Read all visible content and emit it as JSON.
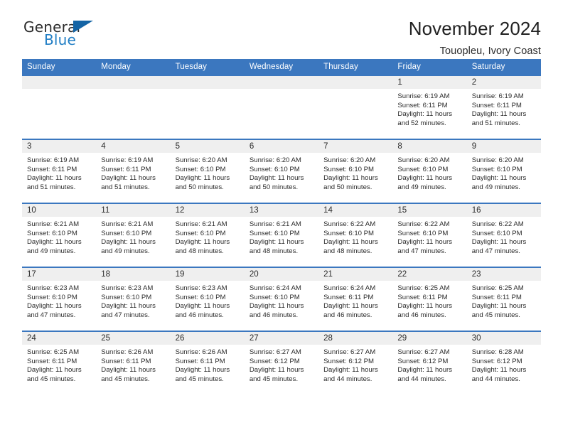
{
  "brand": {
    "name_part1": "General",
    "name_part2": "Blue",
    "triangle_color": "#1464a5",
    "blue_color": "#1f7dc4"
  },
  "header": {
    "title": "November 2024",
    "subtitle": "Touopleu, Ivory Coast",
    "header_bg": "#3b77bf",
    "daynum_bg": "#efefef"
  },
  "weekdays": [
    "Sunday",
    "Monday",
    "Tuesday",
    "Wednesday",
    "Thursday",
    "Friday",
    "Saturday"
  ],
  "weeks": [
    [
      {
        "day": "",
        "sunrise": "",
        "sunset": "",
        "daylight1": "",
        "daylight2": ""
      },
      {
        "day": "",
        "sunrise": "",
        "sunset": "",
        "daylight1": "",
        "daylight2": ""
      },
      {
        "day": "",
        "sunrise": "",
        "sunset": "",
        "daylight1": "",
        "daylight2": ""
      },
      {
        "day": "",
        "sunrise": "",
        "sunset": "",
        "daylight1": "",
        "daylight2": ""
      },
      {
        "day": "",
        "sunrise": "",
        "sunset": "",
        "daylight1": "",
        "daylight2": ""
      },
      {
        "day": "1",
        "sunrise": "Sunrise: 6:19 AM",
        "sunset": "Sunset: 6:11 PM",
        "daylight1": "Daylight: 11 hours",
        "daylight2": "and 52 minutes."
      },
      {
        "day": "2",
        "sunrise": "Sunrise: 6:19 AM",
        "sunset": "Sunset: 6:11 PM",
        "daylight1": "Daylight: 11 hours",
        "daylight2": "and 51 minutes."
      }
    ],
    [
      {
        "day": "3",
        "sunrise": "Sunrise: 6:19 AM",
        "sunset": "Sunset: 6:11 PM",
        "daylight1": "Daylight: 11 hours",
        "daylight2": "and 51 minutes."
      },
      {
        "day": "4",
        "sunrise": "Sunrise: 6:19 AM",
        "sunset": "Sunset: 6:11 PM",
        "daylight1": "Daylight: 11 hours",
        "daylight2": "and 51 minutes."
      },
      {
        "day": "5",
        "sunrise": "Sunrise: 6:20 AM",
        "sunset": "Sunset: 6:10 PM",
        "daylight1": "Daylight: 11 hours",
        "daylight2": "and 50 minutes."
      },
      {
        "day": "6",
        "sunrise": "Sunrise: 6:20 AM",
        "sunset": "Sunset: 6:10 PM",
        "daylight1": "Daylight: 11 hours",
        "daylight2": "and 50 minutes."
      },
      {
        "day": "7",
        "sunrise": "Sunrise: 6:20 AM",
        "sunset": "Sunset: 6:10 PM",
        "daylight1": "Daylight: 11 hours",
        "daylight2": "and 50 minutes."
      },
      {
        "day": "8",
        "sunrise": "Sunrise: 6:20 AM",
        "sunset": "Sunset: 6:10 PM",
        "daylight1": "Daylight: 11 hours",
        "daylight2": "and 49 minutes."
      },
      {
        "day": "9",
        "sunrise": "Sunrise: 6:20 AM",
        "sunset": "Sunset: 6:10 PM",
        "daylight1": "Daylight: 11 hours",
        "daylight2": "and 49 minutes."
      }
    ],
    [
      {
        "day": "10",
        "sunrise": "Sunrise: 6:21 AM",
        "sunset": "Sunset: 6:10 PM",
        "daylight1": "Daylight: 11 hours",
        "daylight2": "and 49 minutes."
      },
      {
        "day": "11",
        "sunrise": "Sunrise: 6:21 AM",
        "sunset": "Sunset: 6:10 PM",
        "daylight1": "Daylight: 11 hours",
        "daylight2": "and 49 minutes."
      },
      {
        "day": "12",
        "sunrise": "Sunrise: 6:21 AM",
        "sunset": "Sunset: 6:10 PM",
        "daylight1": "Daylight: 11 hours",
        "daylight2": "and 48 minutes."
      },
      {
        "day": "13",
        "sunrise": "Sunrise: 6:21 AM",
        "sunset": "Sunset: 6:10 PM",
        "daylight1": "Daylight: 11 hours",
        "daylight2": "and 48 minutes."
      },
      {
        "day": "14",
        "sunrise": "Sunrise: 6:22 AM",
        "sunset": "Sunset: 6:10 PM",
        "daylight1": "Daylight: 11 hours",
        "daylight2": "and 48 minutes."
      },
      {
        "day": "15",
        "sunrise": "Sunrise: 6:22 AM",
        "sunset": "Sunset: 6:10 PM",
        "daylight1": "Daylight: 11 hours",
        "daylight2": "and 47 minutes."
      },
      {
        "day": "16",
        "sunrise": "Sunrise: 6:22 AM",
        "sunset": "Sunset: 6:10 PM",
        "daylight1": "Daylight: 11 hours",
        "daylight2": "and 47 minutes."
      }
    ],
    [
      {
        "day": "17",
        "sunrise": "Sunrise: 6:23 AM",
        "sunset": "Sunset: 6:10 PM",
        "daylight1": "Daylight: 11 hours",
        "daylight2": "and 47 minutes."
      },
      {
        "day": "18",
        "sunrise": "Sunrise: 6:23 AM",
        "sunset": "Sunset: 6:10 PM",
        "daylight1": "Daylight: 11 hours",
        "daylight2": "and 47 minutes."
      },
      {
        "day": "19",
        "sunrise": "Sunrise: 6:23 AM",
        "sunset": "Sunset: 6:10 PM",
        "daylight1": "Daylight: 11 hours",
        "daylight2": "and 46 minutes."
      },
      {
        "day": "20",
        "sunrise": "Sunrise: 6:24 AM",
        "sunset": "Sunset: 6:10 PM",
        "daylight1": "Daylight: 11 hours",
        "daylight2": "and 46 minutes."
      },
      {
        "day": "21",
        "sunrise": "Sunrise: 6:24 AM",
        "sunset": "Sunset: 6:11 PM",
        "daylight1": "Daylight: 11 hours",
        "daylight2": "and 46 minutes."
      },
      {
        "day": "22",
        "sunrise": "Sunrise: 6:25 AM",
        "sunset": "Sunset: 6:11 PM",
        "daylight1": "Daylight: 11 hours",
        "daylight2": "and 46 minutes."
      },
      {
        "day": "23",
        "sunrise": "Sunrise: 6:25 AM",
        "sunset": "Sunset: 6:11 PM",
        "daylight1": "Daylight: 11 hours",
        "daylight2": "and 45 minutes."
      }
    ],
    [
      {
        "day": "24",
        "sunrise": "Sunrise: 6:25 AM",
        "sunset": "Sunset: 6:11 PM",
        "daylight1": "Daylight: 11 hours",
        "daylight2": "and 45 minutes."
      },
      {
        "day": "25",
        "sunrise": "Sunrise: 6:26 AM",
        "sunset": "Sunset: 6:11 PM",
        "daylight1": "Daylight: 11 hours",
        "daylight2": "and 45 minutes."
      },
      {
        "day": "26",
        "sunrise": "Sunrise: 6:26 AM",
        "sunset": "Sunset: 6:11 PM",
        "daylight1": "Daylight: 11 hours",
        "daylight2": "and 45 minutes."
      },
      {
        "day": "27",
        "sunrise": "Sunrise: 6:27 AM",
        "sunset": "Sunset: 6:12 PM",
        "daylight1": "Daylight: 11 hours",
        "daylight2": "and 45 minutes."
      },
      {
        "day": "28",
        "sunrise": "Sunrise: 6:27 AM",
        "sunset": "Sunset: 6:12 PM",
        "daylight1": "Daylight: 11 hours",
        "daylight2": "and 44 minutes."
      },
      {
        "day": "29",
        "sunrise": "Sunrise: 6:27 AM",
        "sunset": "Sunset: 6:12 PM",
        "daylight1": "Daylight: 11 hours",
        "daylight2": "and 44 minutes."
      },
      {
        "day": "30",
        "sunrise": "Sunrise: 6:28 AM",
        "sunset": "Sunset: 6:12 PM",
        "daylight1": "Daylight: 11 hours",
        "daylight2": "and 44 minutes."
      }
    ]
  ]
}
